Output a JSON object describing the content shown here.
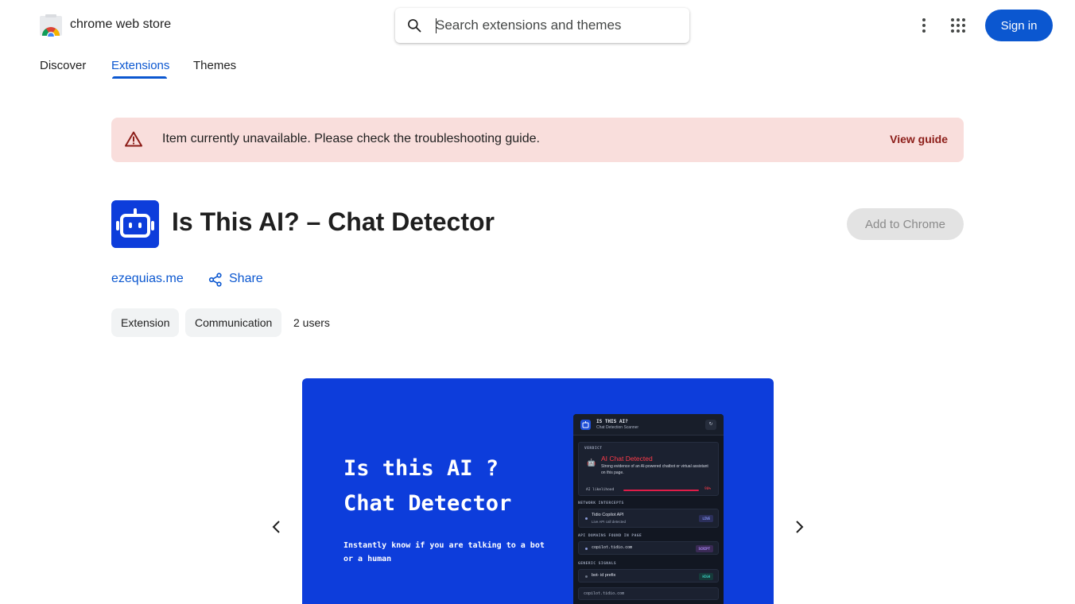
{
  "header": {
    "brand": "chrome web store",
    "search_placeholder": "Search extensions and themes",
    "sign_in": "Sign in"
  },
  "tabs": [
    {
      "label": "Discover",
      "active": false
    },
    {
      "label": "Extensions",
      "active": true
    },
    {
      "label": "Themes",
      "active": false
    }
  ],
  "banner": {
    "message": "Item currently unavailable. Please check the troubleshooting guide.",
    "link": "View guide"
  },
  "extension": {
    "title": "Is This AI? – Chat Detector",
    "add_button": "Add to Chrome",
    "author": "ezequias.me",
    "share": "Share",
    "chips": [
      "Extension",
      "Communication"
    ],
    "users": "2 users"
  },
  "slide": {
    "heading_line1": "Is this AI ?",
    "heading_line2": "Chat Detector",
    "subtitle": "Instantly know if you are talking to a bot or a human",
    "panel": {
      "app_title": "IS THIS AI?",
      "app_subtitle": "Chat Detection Scanner",
      "refresh": "↻",
      "verdict_label": "VERDICT",
      "verdict": "AI Chat Detected",
      "verdict_desc": "Strong evidence of an AI-powered chatbot or virtual assistant on this page.",
      "likelihood_label": "AI likelihood",
      "likelihood_pct": "90%",
      "likelihood": 0.9,
      "network_label": "NETWORK INTERCEPTS",
      "network_item": "Tidio Copilot API",
      "network_item_sub": "Live API call detected",
      "network_tag": "LIVE",
      "api_label": "API DOMAINS FOUND IN PAGE",
      "api_item": "copilot.tidio.com",
      "api_tag": "SCRIPT",
      "generic_label": "GENERIC SIGNALS",
      "generic_item": "bot- id prefix",
      "generic_tag": "HIGH",
      "footer_item": "copilot.tidio.com"
    }
  },
  "colors": {
    "primary": "#0b57d0",
    "banner_bg": "#f9dedc",
    "banner_link": "#8c1d18",
    "slide_bg": "#0d3ddb",
    "alert_red": "#ff3b4a"
  }
}
